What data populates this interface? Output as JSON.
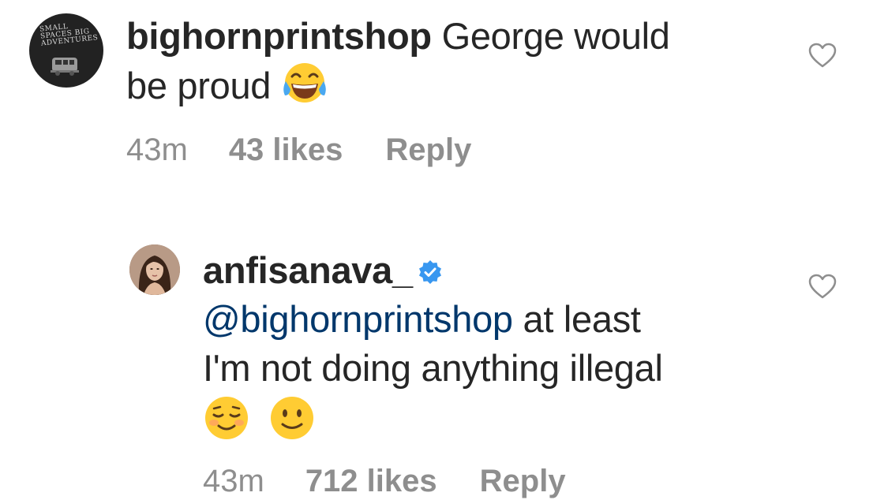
{
  "comments": [
    {
      "username": "bighornprintshop",
      "text_line1": "George would",
      "text_line2": "be proud",
      "time": "43m",
      "likes": "43 likes",
      "reply": "Reply",
      "avatar_logo_text": "SMALL SPACES BIG ADVENTURES",
      "icons": [
        "tears-of-joy-emoji",
        "heart-icon"
      ]
    },
    {
      "username": "anfisanava_",
      "verified": true,
      "mention": "@bighornprintshop",
      "text_line1": "at least",
      "text_line2": "I'm not doing anything illegal",
      "time": "43m",
      "likes": "712 likes",
      "reply": "Reply",
      "icons": [
        "verified-badge-icon",
        "relieved-face-emoji",
        "slightly-smiling-face-emoji",
        "heart-icon"
      ]
    }
  ],
  "colors": {
    "text": "#262626",
    "meta": "#8e8e8e",
    "mention": "#00376b",
    "verified": "#3897f0"
  }
}
